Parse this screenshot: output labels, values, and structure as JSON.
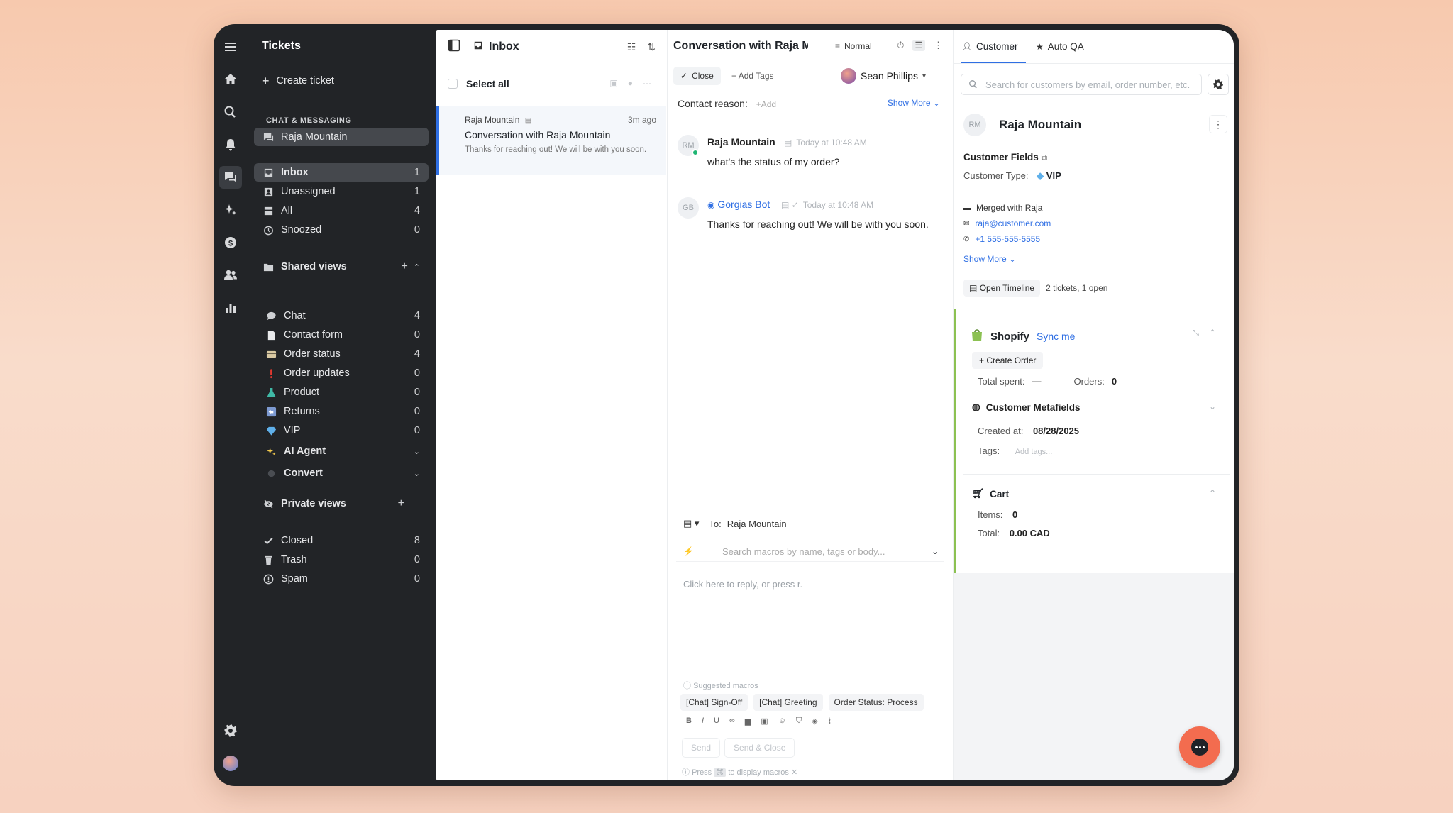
{
  "sidebar": {
    "title": "Tickets",
    "create_ticket": "Create ticket",
    "section_chat": "CHAT & MESSAGING",
    "chat_channel": "Raja Mountain",
    "views": [
      {
        "label": "Inbox",
        "count": "1"
      },
      {
        "label": "Unassigned",
        "count": "1"
      },
      {
        "label": "All",
        "count": "4"
      },
      {
        "label": "Snoozed",
        "count": "0"
      }
    ],
    "shared_views_label": "Shared views",
    "shared_views": [
      {
        "label": "Chat",
        "count": "4"
      },
      {
        "label": "Contact form",
        "count": "0"
      },
      {
        "label": "Order status",
        "count": "4"
      },
      {
        "label": "Order updates",
        "count": "0"
      },
      {
        "label": "Product",
        "count": "0"
      },
      {
        "label": "Returns",
        "count": "0"
      },
      {
        "label": "VIP",
        "count": "0"
      }
    ],
    "ai_agent": "AI Agent",
    "convert": "Convert",
    "private_views_label": "Private views",
    "system_views": [
      {
        "label": "Closed",
        "count": "8"
      },
      {
        "label": "Trash",
        "count": "0"
      },
      {
        "label": "Spam",
        "count": "0"
      }
    ]
  },
  "inbox": {
    "title": "Inbox",
    "select_all": "Select all",
    "item": {
      "from": "Raja Mountain",
      "time": "3m ago",
      "subject": "Conversation with Raja Mountain",
      "preview": "Thanks for reaching out! We will be with you soon."
    }
  },
  "conversation": {
    "title": "Conversation with Raja Mountain",
    "priority": "Normal",
    "close_label": "Close",
    "add_tags": "Add Tags",
    "assignee": "Sean Phillips",
    "contact_reason_label": "Contact reason:",
    "contact_reason_add": "+Add",
    "show_more": "Show More",
    "messages": [
      {
        "initials": "RM",
        "name": "Raja Mountain",
        "time": "Today at 10:48 AM",
        "body": "what's the status of my order?"
      },
      {
        "initials": "GB",
        "name": "Gorgias Bot",
        "time": "Today at 10:48 AM",
        "body": "Thanks for reaching out! We will be with you soon."
      }
    ],
    "composer": {
      "to_label": "To:",
      "to_value": "Raja Mountain",
      "macro_placeholder": "Search macros by name, tags or body...",
      "reply_placeholder": "Click here to reply, or press r.",
      "suggested_label": "Suggested macros",
      "chips": [
        "[Chat] Sign-Off",
        "[Chat] Greeting",
        "Order Status: Process"
      ],
      "send": "Send",
      "send_close": "Send & Close",
      "hint_pre": "Press",
      "hint_post": "to display macros"
    }
  },
  "customer": {
    "tab_customer": "Customer",
    "tab_autoqa": "Auto QA",
    "search_placeholder": "Search for customers by email, order number, etc.",
    "initials": "RM",
    "name": "Raja Mountain",
    "fields_title": "Customer Fields",
    "type_label": "Customer Type:",
    "type_value": "VIP",
    "merged": "Merged with Raja",
    "email": "raja@customer.com",
    "phone": "+1 555-555-5555",
    "show_more": "Show More",
    "timeline_btn": "Open Timeline",
    "timeline_note": "2 tickets, 1 open",
    "shopify": {
      "title": "Shopify",
      "sync": "Sync me",
      "create_order": "Create Order",
      "total_spent_label": "Total spent:",
      "total_spent_value": "—",
      "orders_label": "Orders:",
      "orders_value": "0",
      "metafields_title": "Customer Metafields",
      "created_label": "Created at:",
      "created_value": "08/28/2025",
      "tags_label": "Tags:",
      "tags_placeholder": "Add tags...",
      "cart_title": "Cart",
      "items_label": "Items:",
      "items_value": "0",
      "total_label": "Total:",
      "total_value": "0.00 CAD"
    }
  },
  "colors": {
    "accent": "#2f6fe4",
    "sidebar_bg": "#222427",
    "shopify_green": "#8cc152",
    "fab": "#f36c4f"
  }
}
